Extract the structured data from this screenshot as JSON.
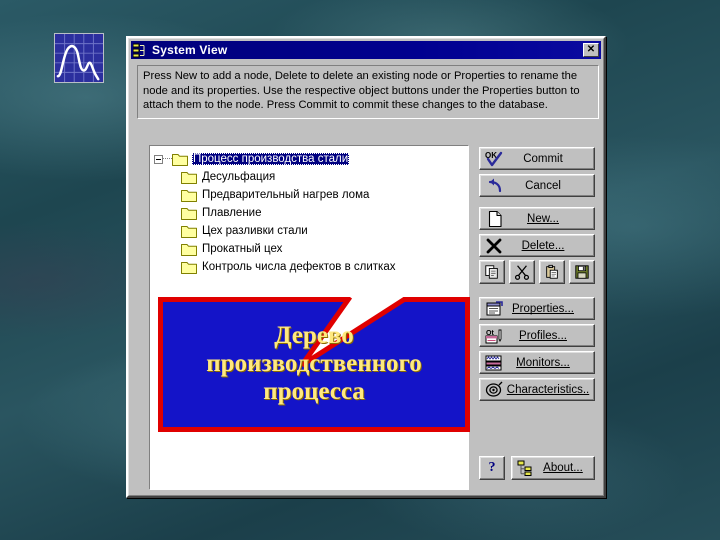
{
  "slide": {
    "background_color": "#24515c",
    "logo": {
      "name": "chart-logo",
      "frame_color": "#2c2f9e"
    }
  },
  "dialog": {
    "title": "System View",
    "title_icon": "hierarchy-icon",
    "close_label": "✕",
    "instructions": "Press New to add a node, Delete to delete an existing node or Properties to rename the node and its properties. Use the respective object buttons under the Properties button to attach them to the node. Press Commit to commit these changes to the database.",
    "tree": {
      "root": {
        "label": "Процесс производства стали",
        "selected": true,
        "expanded": true
      },
      "children": [
        {
          "label": "Десульфация"
        },
        {
          "label": "Предварительный нагрев лома"
        },
        {
          "label": "Плавление"
        },
        {
          "label": "Цех разливки стали"
        },
        {
          "label": "Прокатный цех"
        },
        {
          "label": "Контроль числа дефектов в слитках"
        }
      ]
    },
    "buttons": [
      {
        "key": "commit",
        "label": "Commit",
        "accel": "",
        "icon": "ok-check-icon"
      },
      {
        "key": "cancel",
        "label": "Cancel",
        "accel": "",
        "icon": "undo-arrow-icon"
      },
      {
        "key": "new",
        "label": "New...",
        "accel": "N",
        "icon": "document-icon"
      },
      {
        "key": "delete",
        "label": "Delete...",
        "accel": "D",
        "icon": "x-mark-icon"
      },
      {
        "key": "properties",
        "label": "Properties...",
        "accel": "P",
        "icon": "properties-icon"
      },
      {
        "key": "profiles",
        "label": "Profiles...",
        "accel": "r",
        "icon": "profiles-icon"
      },
      {
        "key": "monitors",
        "label": "Monitors...",
        "accel": "M",
        "icon": "monitors-icon"
      },
      {
        "key": "characteristics",
        "label": "Characteristics..",
        "accel": "C",
        "icon": "characteristics-icon"
      },
      {
        "key": "about",
        "label": "About...",
        "accel": "A",
        "icon": "hierarchy-icon"
      }
    ],
    "toolbuttons": [
      {
        "key": "copy",
        "icon": "copy-icon"
      },
      {
        "key": "cut",
        "icon": "scissors-icon"
      },
      {
        "key": "paste",
        "icon": "clipboard-icon"
      },
      {
        "key": "save",
        "icon": "floppy-disk-icon"
      }
    ],
    "help_button": {
      "label": "?",
      "icon": "question-mark-icon"
    }
  },
  "callout": {
    "line1": "Дерево",
    "line2": "производственного",
    "line3": "процесса",
    "fill_color": "#1414c8",
    "border_color": "#e00000",
    "text_color": "#ffe97f"
  }
}
